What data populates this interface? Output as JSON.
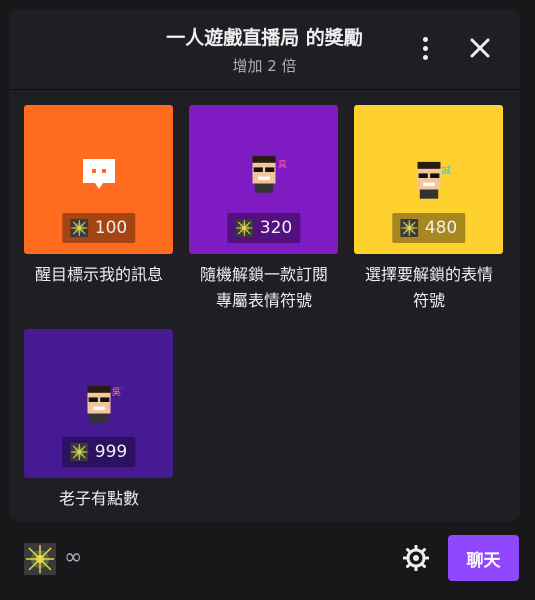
{
  "header": {
    "title": "一人遊戲直播局 的獎勵",
    "subtitle": "增加 2 倍"
  },
  "rewards": [
    {
      "label": "醒目標示我的訊息",
      "cost": "100",
      "color": "#ff6b1f",
      "icon": "highlight-message-icon"
    },
    {
      "label": "隨機解鎖一款訂閱\n專屬表情符號",
      "cost": "320",
      "color": "#7f1bc2",
      "icon": "emote-icon"
    },
    {
      "label": "選擇要解鎖的表情\n符號",
      "cost": "480",
      "color": "#ffd12e",
      "icon": "emote-icon"
    },
    {
      "label": "老子有點數",
      "cost": "999",
      "color": "#451a93",
      "icon": "emote-icon"
    }
  ],
  "emote_captions": [
    "真香",
    "誠意",
    "吳軍"
  ],
  "footer": {
    "balance": "∞",
    "chat_label": "聊天"
  }
}
